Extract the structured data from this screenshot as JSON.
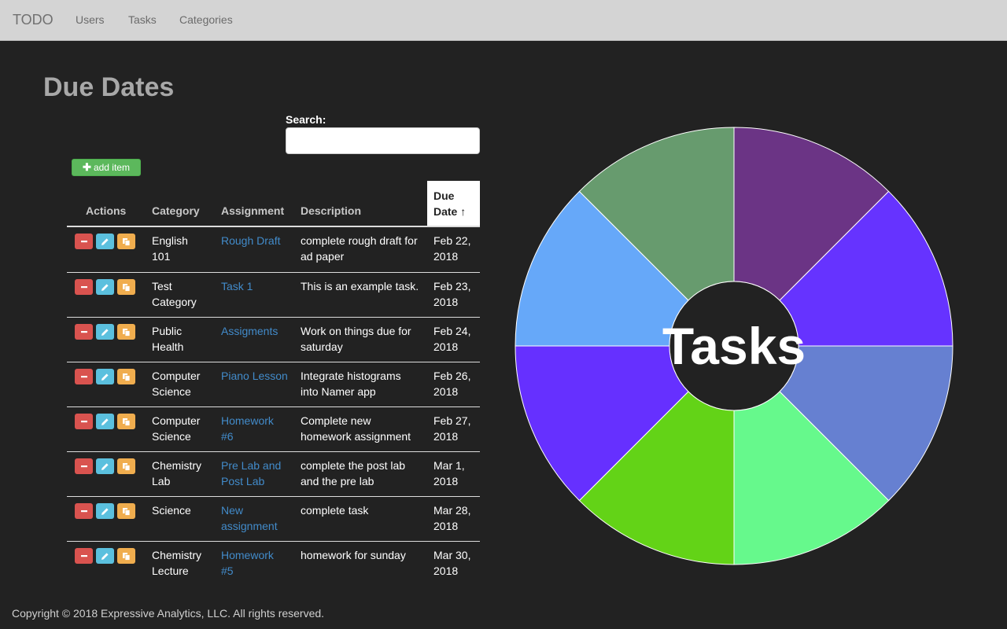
{
  "navbar": {
    "brand": "TODO",
    "links": [
      "Users",
      "Tasks",
      "Categories"
    ]
  },
  "page": {
    "title": "Due Dates"
  },
  "search": {
    "label": "Search:",
    "value": "",
    "placeholder": ""
  },
  "toolbar": {
    "add_label": "add item",
    "add_icon": "plus-icon"
  },
  "table": {
    "columns": [
      "Actions",
      "Category",
      "Assignment",
      "Description",
      "Due",
      "Date"
    ],
    "sort_indicator": "↑",
    "row_action_icons": [
      "minus-icon",
      "pencil-icon",
      "copy-icon"
    ],
    "rows": [
      {
        "category": [
          "English",
          "101"
        ],
        "assignment": [
          "Rough Draft"
        ],
        "description": [
          "complete rough draft for",
          "ad paper"
        ],
        "due": [
          "Feb 22,",
          "2018"
        ]
      },
      {
        "category": [
          "Test",
          "Category"
        ],
        "assignment": [
          "Task 1"
        ],
        "description": [
          "This is an example task."
        ],
        "due": [
          "Feb 23,",
          "2018"
        ]
      },
      {
        "category": [
          "Public",
          "Health"
        ],
        "assignment": [
          "Assigments"
        ],
        "description": [
          "Work on things due for",
          "saturday"
        ],
        "due": [
          "Feb 24,",
          "2018"
        ]
      },
      {
        "category": [
          "Computer",
          "Science"
        ],
        "assignment": [
          "Piano Lesson"
        ],
        "description": [
          "Integrate histograms",
          "into Namer app"
        ],
        "due": [
          "Feb 26,",
          "2018"
        ]
      },
      {
        "category": [
          "Computer",
          "Science"
        ],
        "assignment": [
          "Homework",
          "#6"
        ],
        "description": [
          "Complete new",
          "homework assignment"
        ],
        "due": [
          "Feb 27,",
          "2018"
        ]
      },
      {
        "category": [
          "Chemistry",
          "Lab"
        ],
        "assignment": [
          "Pre Lab and",
          "Post Lab"
        ],
        "description": [
          "complete the post lab",
          "and the pre lab"
        ],
        "due": [
          "Mar 1,",
          "2018"
        ]
      },
      {
        "category": [
          "Science"
        ],
        "assignment": [
          "New",
          "assignment"
        ],
        "description": [
          "complete task"
        ],
        "due": [
          "Mar 28,",
          "2018"
        ]
      },
      {
        "category": [
          "Chemistry",
          "Lecture"
        ],
        "assignment": [
          "Homework",
          "#5"
        ],
        "description": [
          "homework for sunday"
        ],
        "due": [
          "Mar 30,",
          "2018"
        ]
      }
    ]
  },
  "chart_data": {
    "type": "pie",
    "center_label": "Tasks",
    "values": [
      1,
      1,
      1,
      1,
      1,
      1,
      1,
      1
    ],
    "colors": [
      "#6b3485",
      "#6633ff",
      "#6680d1",
      "#66f98c",
      "#63d317",
      "#6630ff",
      "#66a8f9",
      "#679b6e"
    ]
  },
  "footer": {
    "text": "Copyright © 2018 Expressive Analytics, LLC. All rights reserved."
  }
}
